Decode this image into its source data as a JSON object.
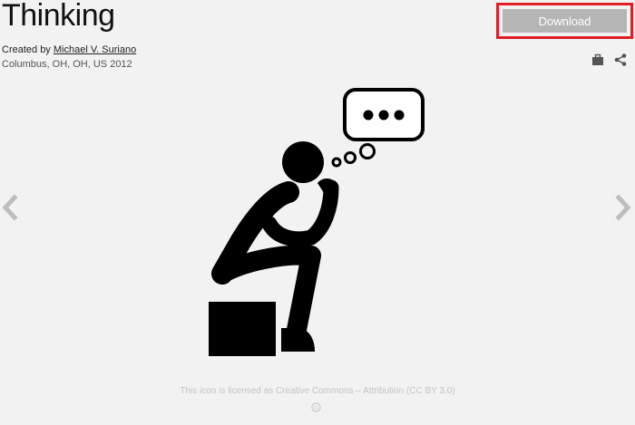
{
  "icon": {
    "title": "Thinking",
    "creator_prefix": "Created by",
    "creator_name": "Michael V. Suriano",
    "location_year": "Columbus, OH, OH, US 2012",
    "subject": "thinking-person-icon"
  },
  "actions": {
    "download_label": "Download",
    "briefcase_icon": "briefcase-icon",
    "share_icon": "share-icon"
  },
  "navigation": {
    "prev_icon": "chevron-left-icon",
    "next_icon": "chevron-right-icon"
  },
  "license": {
    "text": "This icon is licensed as Creative Commons – Attribution (CC BY 3.0)",
    "badge_icon": "creative-commons-icon"
  },
  "colors": {
    "background": "#f2f2f2",
    "download_button": "#b5b5b5",
    "highlight_outline": "#e01e25",
    "icon_fill": "#000000"
  }
}
